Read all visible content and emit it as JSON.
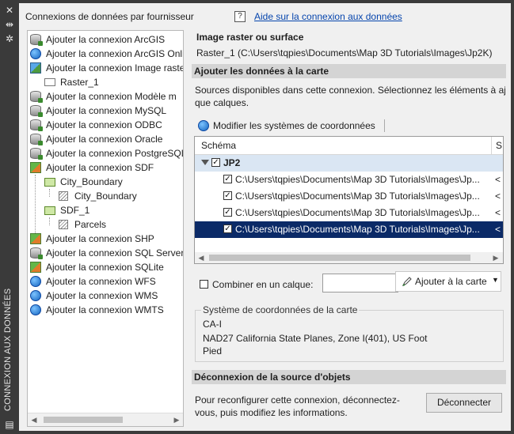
{
  "palette": {
    "title_bar": "#3b3b3b",
    "panel": "#f0f0f0",
    "section_header": "#d4d4d4",
    "selected_row": "#0b2a67",
    "group_row": "#dae6f3",
    "link": "#0645ad"
  },
  "window": {
    "vertical_title": "CONNEXION AUX DONNÉES",
    "left_heading": "Connexions de données par fournisseur",
    "help_icon": "?",
    "help_link": "Aide sur la connexion aux données"
  },
  "tree": [
    {
      "label": "Ajouter la connexion ArcGIS",
      "icon": "database-icon"
    },
    {
      "label": "Ajouter la connexion ArcGIS Online",
      "icon": "globe-icon"
    },
    {
      "label": "Ajouter la connexion Image raster",
      "icon": "raster-icon"
    },
    {
      "label": "Raster_1",
      "icon": "folder-icon"
    },
    {
      "label": "Ajouter la connexion Modèle m",
      "icon": "database-icon"
    },
    {
      "label": "Ajouter la connexion MySQL",
      "icon": "database-icon"
    },
    {
      "label": "Ajouter la connexion ODBC",
      "icon": "database-icon"
    },
    {
      "label": "Ajouter la connexion Oracle",
      "icon": "database-icon"
    },
    {
      "label": "Ajouter la connexion PostgreSQL",
      "icon": "database-icon"
    },
    {
      "label": "Ajouter la connexion SDF",
      "icon": "sdf-icon"
    },
    {
      "label": "City_Boundary",
      "icon": "feature-class-icon"
    },
    {
      "label": "City_Boundary",
      "icon": "feature-type-icon"
    },
    {
      "label": "SDF_1",
      "icon": "feature-class-icon"
    },
    {
      "label": "Parcels",
      "icon": "feature-type-icon"
    },
    {
      "label": "Ajouter la connexion SHP",
      "icon": "sdf-icon"
    },
    {
      "label": "Ajouter la connexion SQL Server",
      "icon": "database-icon"
    },
    {
      "label": "Ajouter la connexion SQLite",
      "icon": "sdf-icon"
    },
    {
      "label": "Ajouter la connexion WFS",
      "icon": "globe-icon"
    },
    {
      "label": "Ajouter la connexion WMS",
      "icon": "globe-icon"
    },
    {
      "label": "Ajouter la connexion WMTS",
      "icon": "globe-icon"
    }
  ],
  "details": {
    "title": "Image raster ou surface",
    "path": "Raster_1 (C:\\Users\\tqpies\\Documents\\Map 3D Tutorials\\Images\\Jp2K)"
  },
  "add_section": {
    "header": "Ajouter les données à la carte",
    "desc_line1": "Sources disponibles dans cette connexion. Sélectionnez les éléments à ajo",
    "desc_line2": "que calques.",
    "coord_button": "Modifier les systèmes de coordonnées"
  },
  "grid": {
    "col_schema": "Schéma",
    "col_second": "S",
    "group": "JP2",
    "group_checked": true,
    "rows": [
      {
        "path": "C:\\Users\\tqpies\\Documents\\Map 3D Tutorials\\Images\\Jp...",
        "tail": "<",
        "checked": true,
        "selected": false
      },
      {
        "path": "C:\\Users\\tqpies\\Documents\\Map 3D Tutorials\\Images\\Jp...",
        "tail": "<",
        "checked": true,
        "selected": false
      },
      {
        "path": "C:\\Users\\tqpies\\Documents\\Map 3D Tutorials\\Images\\Jp...",
        "tail": "<",
        "checked": true,
        "selected": false
      },
      {
        "path": "C:\\Users\\tqpies\\Documents\\Map 3D Tutorials\\Images\\Jp...",
        "tail": "<",
        "checked": true,
        "selected": true
      }
    ]
  },
  "combine": {
    "label": "Combiner en un calque:",
    "checked": false,
    "value": ""
  },
  "add_button": {
    "label": "Ajouter à la carte"
  },
  "coord_system": {
    "legend": "Système de coordonnées de la carte",
    "code": "CA-I",
    "desc1": "NAD27 California State Planes, Zone I(401), US Foot",
    "desc2": "Pied"
  },
  "disconnect": {
    "header": "Déconnexion de la source d'objets",
    "text1": "Pour reconfigurer cette connexion, déconnectez-",
    "text2": "vous, puis modifiez les informations.",
    "button": "Déconnecter"
  }
}
